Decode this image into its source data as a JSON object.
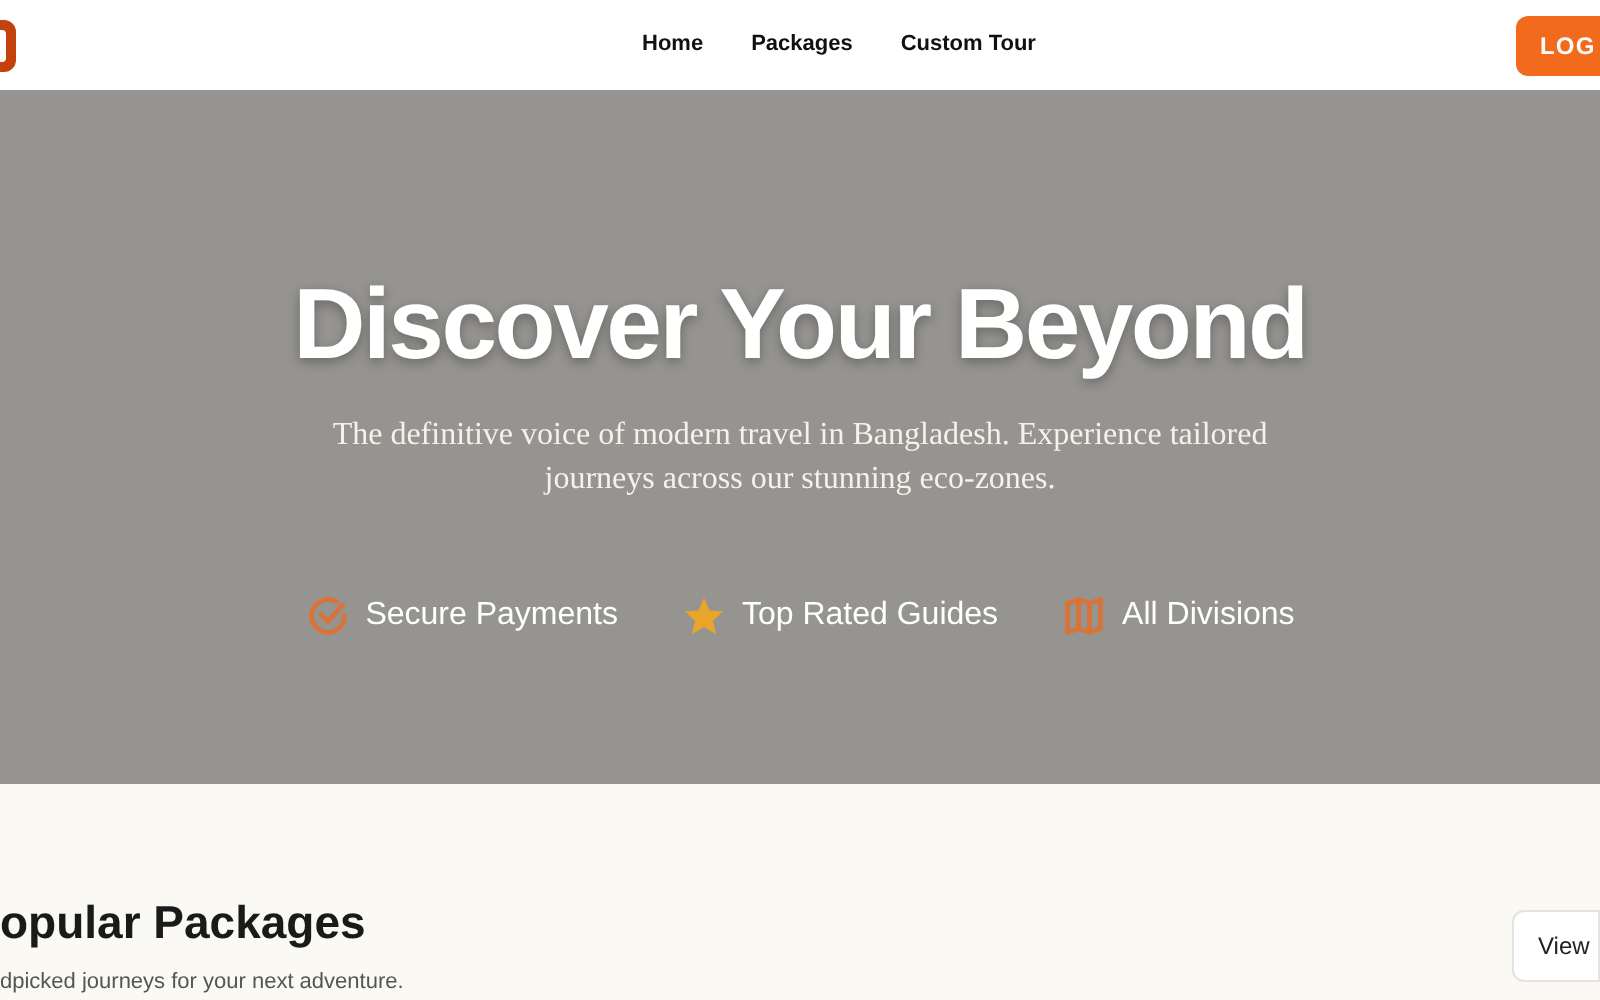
{
  "nav": {
    "links": [
      "Home",
      "Packages",
      "Custom Tour"
    ],
    "login": "LOG"
  },
  "hero": {
    "title": "Discover Your Beyond",
    "subtitle": "The definitive voice of modern travel in Bangladesh. Experience tailored journeys across our stunning eco-zones.",
    "features": [
      {
        "kind": "check",
        "label": "Secure Payments"
      },
      {
        "kind": "star",
        "label": "Top Rated Guides"
      },
      {
        "kind": "map",
        "label": "All Divisions"
      }
    ]
  },
  "section": {
    "title": "opular Packages",
    "subtitle": "dpicked journeys for your next adventure.",
    "button": "View"
  }
}
